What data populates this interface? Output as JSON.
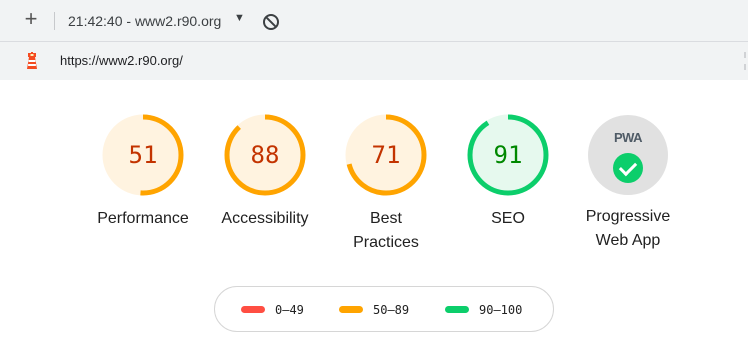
{
  "toolbar": {
    "new_icon": "plus-icon",
    "session_label": "21:42:40 - www2.r90.org",
    "dropdown_icon": "caret-down-icon",
    "clear_icon": "block-icon"
  },
  "urlbar": {
    "logo_icon": "lighthouse-icon",
    "url": "https://www2.r90.org/"
  },
  "colors": {
    "average": "#ffa400",
    "average_bg": "#fff3e0",
    "pass": "#0cce6b",
    "pass_text": "#008800",
    "pass_bg": "#e6f9ee",
    "fail": "#ff4e42",
    "average_text": "#c33300"
  },
  "categories": [
    {
      "id": "performance",
      "score": "51",
      "score_value": 51,
      "label_lines": [
        "Performance"
      ],
      "rating": "average"
    },
    {
      "id": "accessibility",
      "score": "88",
      "score_value": 88,
      "label_lines": [
        "Accessibility"
      ],
      "rating": "average"
    },
    {
      "id": "best-practices",
      "score": "71",
      "score_value": 71,
      "label_lines": [
        "Best",
        "Practices"
      ],
      "rating": "average"
    },
    {
      "id": "seo",
      "score": "91",
      "score_value": 91,
      "label_lines": [
        "SEO"
      ],
      "rating": "pass"
    }
  ],
  "pwa": {
    "badge_text": "PWA",
    "check_icon": "check-icon",
    "label_lines": [
      "Progressive",
      "Web App"
    ]
  },
  "legend": [
    {
      "range": "0–49",
      "color": "#ff4e42"
    },
    {
      "range": "50–89",
      "color": "#ffa400"
    },
    {
      "range": "90–100",
      "color": "#0cce6b"
    }
  ]
}
